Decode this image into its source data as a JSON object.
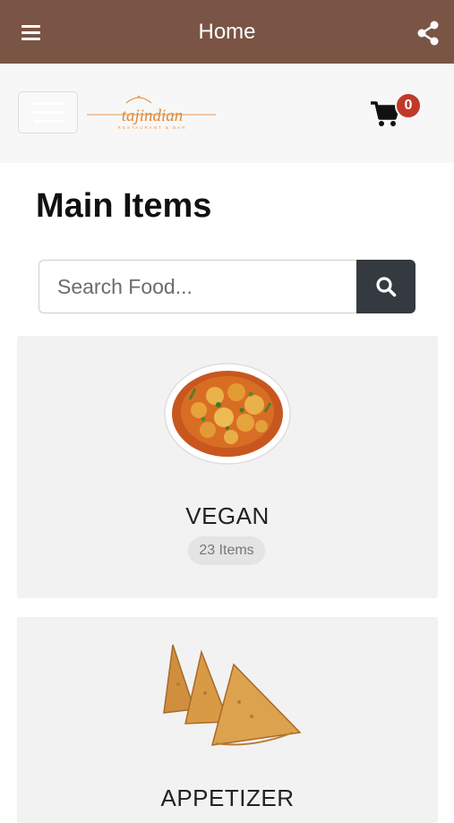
{
  "app_bar": {
    "title": "Home",
    "menu_icon": "hamburger-menu-icon",
    "share_icon": "share-icon",
    "color": "#7a5444"
  },
  "header": {
    "logo_text": "tajindian",
    "logo_subtext": "RESTAURANT & BAR",
    "cart_count": "0",
    "cart_icon": "shopping-cart-icon",
    "badge_color": "#c0392b"
  },
  "page": {
    "title": "Main Items"
  },
  "search": {
    "placeholder": "Search Food...",
    "value": "",
    "button_icon": "search-icon",
    "button_color": "#343a40"
  },
  "categories": [
    {
      "name": "VEGAN",
      "count": "23 Items",
      "image": "vegetable-curry-bowl"
    },
    {
      "name": "APPETIZER",
      "count": "",
      "image": "samosas"
    }
  ]
}
